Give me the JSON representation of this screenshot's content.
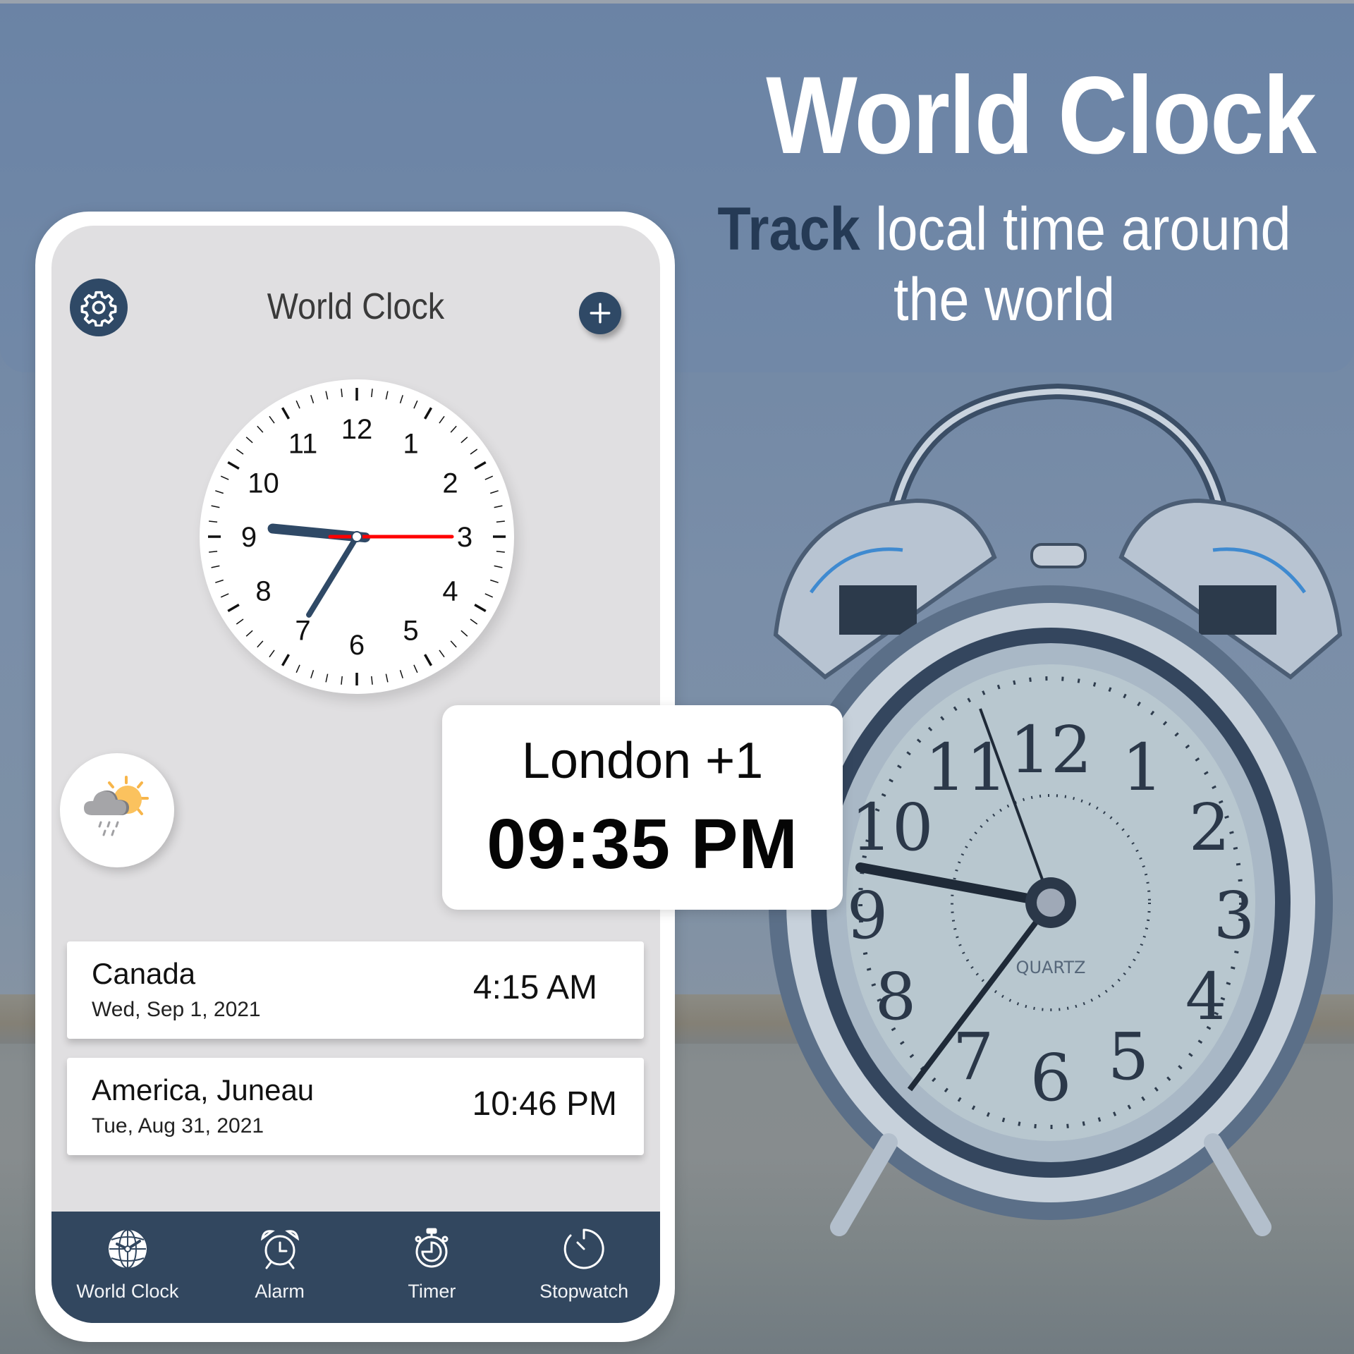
{
  "banner": {
    "title": "World Clock",
    "subtitle_highlight": "Track",
    "subtitle_rest": " local time around the world"
  },
  "app": {
    "title": "World Clock",
    "settings_icon": "gear-icon",
    "add_icon": "plus-icon",
    "weather_icon": "partly-cloudy-rain-icon"
  },
  "analog_clock": {
    "numerals": [
      "12",
      "1",
      "2",
      "3",
      "4",
      "5",
      "6",
      "7",
      "8",
      "9",
      "10",
      "11"
    ],
    "time": {
      "hour": 9,
      "minute": 35,
      "second": 15
    },
    "hand_color": "#2f4966",
    "second_hand_color": "#ff0000"
  },
  "featured": {
    "city": "London +1",
    "time": "09:35 PM"
  },
  "cities": [
    {
      "name": "Canada",
      "date": "Wed, Sep 1, 2021",
      "time": "4:15 AM"
    },
    {
      "name": "America, Juneau",
      "date": "Tue, Aug 31, 2021",
      "time": "10:46 PM"
    }
  ],
  "nav": [
    {
      "label": "World Clock",
      "icon": "globe-clock-icon",
      "active": true
    },
    {
      "label": "Alarm",
      "icon": "alarm-clock-icon",
      "active": false
    },
    {
      "label": "Timer",
      "icon": "timer-icon",
      "active": false
    },
    {
      "label": "Stopwatch",
      "icon": "stopwatch-icon",
      "active": false
    }
  ],
  "background_photo": {
    "subject": "silver twin-bell alarm clock",
    "dial_text": "QUARTZ"
  },
  "colors": {
    "accent": "#2f4966",
    "nav_bar": "#32475f",
    "screen_bg": "#e0dfe1",
    "second_hand": "#ff0000"
  }
}
